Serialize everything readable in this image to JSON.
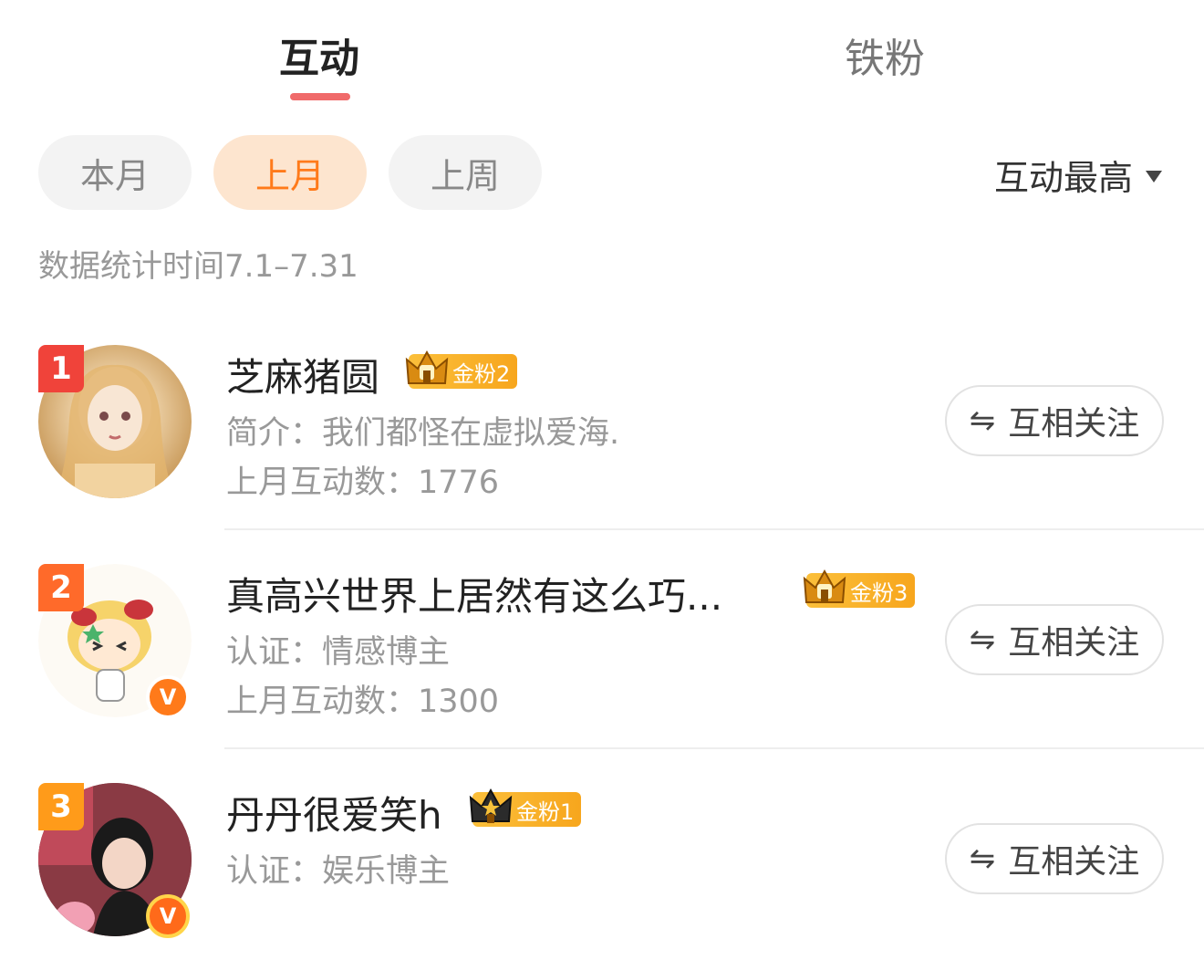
{
  "tabs": {
    "active_label": "互动",
    "inactive_label": "铁粉"
  },
  "filters": {
    "pills": [
      "本月",
      "上月",
      "上周"
    ],
    "selected_index": 1,
    "sort_label": "互动最高"
  },
  "stat_time": "数据统计时间7.1–7.31",
  "rows": [
    {
      "rank": "1",
      "name": "芝麻猪圆",
      "badge": "金粉2",
      "sub1": "简介：我们都怪在虚拟爱海.",
      "sub2": "上月互动数：1776",
      "button": "互相关注"
    },
    {
      "rank": "2",
      "name": "真高兴世界上居然有这么巧...",
      "badge": "金粉3",
      "sub1": "认证：情感博主",
      "sub2": "上月互动数：1300",
      "button": "互相关注"
    },
    {
      "rank": "3",
      "name": "丹丹很爱笑h",
      "badge": "金粉1",
      "sub1": "认证：娱乐博主",
      "button": "互相关注"
    }
  ],
  "colors": {
    "accent": "#ff7a1a",
    "tab_underline": "#f06a6a",
    "rank1": "#f0433a",
    "rank2": "#ff6a2a",
    "rank3": "#ff9b1a",
    "badge_gold": "#f7a61d"
  },
  "icons": {
    "sort": "triangle-down-icon",
    "follow": "mutual-arrows-icon",
    "badge": "crown-icon",
    "verified": "verified-v-icon"
  }
}
